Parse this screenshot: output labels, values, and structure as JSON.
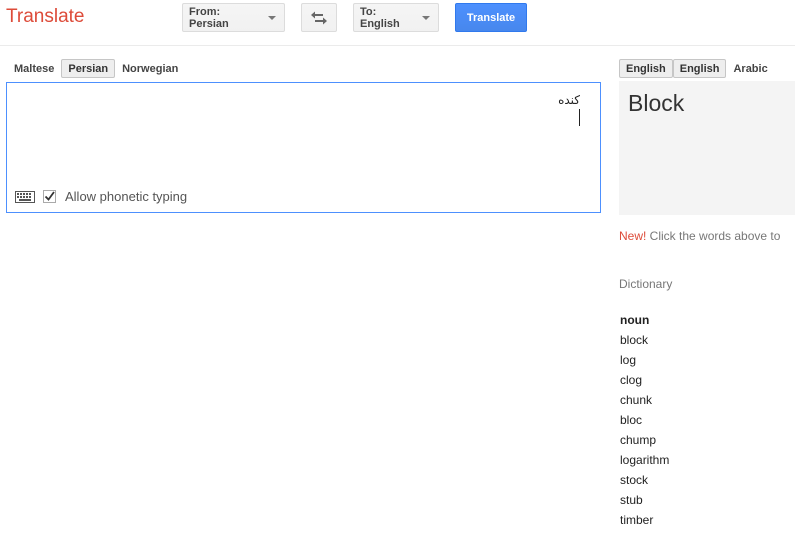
{
  "app": {
    "title": "Translate"
  },
  "toolbar": {
    "from_label": "From: Persian",
    "to_label": "To: English",
    "translate_label": "Translate",
    "swap_icon": "swap-arrows-icon"
  },
  "source": {
    "tabs": [
      {
        "label": "Maltese",
        "selected": false
      },
      {
        "label": "Persian",
        "selected": true
      },
      {
        "label": "Norwegian",
        "selected": false
      }
    ],
    "text": "کنده",
    "keyboard_icon": "keyboard-icon",
    "phonetic": {
      "label": "Allow phonetic typing",
      "checked": true
    }
  },
  "target": {
    "tabs": [
      {
        "label": "English",
        "selected": true
      },
      {
        "label": "English",
        "selected": true
      },
      {
        "label": "Arabic",
        "selected": false
      }
    ],
    "result": "Block",
    "note_new": "New!",
    "note_text": " Click the words above to"
  },
  "dictionary": {
    "title": "Dictionary",
    "pos": "noun",
    "items": [
      "block",
      "log",
      "clog",
      "chunk",
      "bloc",
      "chump",
      "logarithm",
      "stock",
      "stub",
      "timber"
    ]
  },
  "colors": {
    "brand_red": "#dd4b39",
    "action_blue": "#4d90fe",
    "result_bg": "#f4f4f4"
  }
}
